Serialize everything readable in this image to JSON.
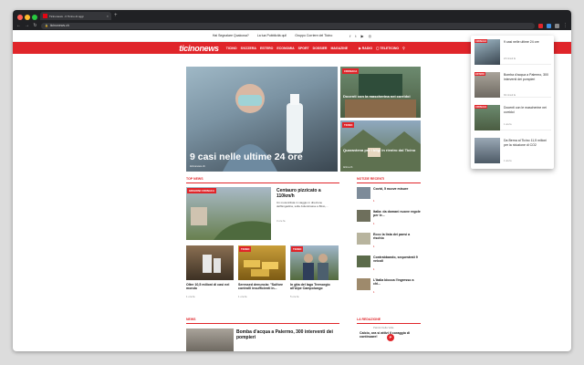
{
  "browser": {
    "tab_title": "Ticinonews - Il Ticino di oggi",
    "url": "ticinonews.ch",
    "tab_close": "×",
    "new_tab": "+",
    "colors": {
      "chrome": "#202124",
      "tab": "#35363a"
    }
  },
  "topbar": {
    "items": [
      "Hai Segnalare Qualcosa?",
      "La tua Pubblicità qui!",
      "Gruppo Corriere del Ticino"
    ],
    "social": [
      "f",
      "t",
      "▶",
      "◎"
    ]
  },
  "nav": {
    "logo": "ticinonews",
    "menu": [
      "TICINO",
      "SVIZZERA",
      "ESTERO",
      "ECONOMIA",
      "SPORT",
      "DOSSIER",
      "MAGAZINE"
    ],
    "radio": "RADIO",
    "teleticino": "TELETICINO",
    "accent": "#e0252a"
  },
  "hero": {
    "title": "9 casi nelle ultime 24 ore",
    "source": "ticinonews.ch",
    "subtitle": "Docenti con la mascherina nei corridoi",
    "subtitle_category": "CRONACA",
    "card2_title": "Quarantena per i bilgi in rientro dal Ticino",
    "card2_category": "TICINO",
    "card2_meta": "ticino.ch"
  },
  "top_news": {
    "heading": "TOP NEWS",
    "featured_category": "GRIGIONI CRONACA",
    "featured_title": "Centauro pizzicato a 110km/h",
    "featured_text": "Un motociclista in viaggio in direzione dell'Engadina, sulla Julierstrasse a Bivio,...",
    "featured_meta": "3 ore fa",
    "cards": [
      {
        "category": "",
        "title": "Oltre 10,5 milioni di casi nel mondo",
        "meta": "1 ora fa"
      },
      {
        "category": "TICINO",
        "title": "Seressed denuncia: \"Sulfore controlli insufficienti in...",
        "meta": "1 ora fa"
      },
      {
        "category": "TICINO",
        "title": "In gita del lago Tremorgio all'Alpe Campolungo",
        "meta": "5 ore fa"
      }
    ]
  },
  "recent": {
    "heading": "NOTIZIE RECENTI",
    "items": [
      {
        "title": "Covid, 5 nuove misure",
        "meta": "1"
      },
      {
        "title": "Italia: da domani nuove regole per le...",
        "meta": "1"
      },
      {
        "title": "Ecco la lista dei paesi a rischio",
        "meta": "1"
      },
      {
        "title": "Contrabbando, sequestrati 9 veicoli",
        "meta": "1"
      },
      {
        "title": "L'Italia blocca l'ingresso a chi...",
        "meta": "1"
      }
    ]
  },
  "news_section": {
    "heading": "NEWS",
    "title": "Bomba d'acqua a Palermo, 300 interventi dei pompieri"
  },
  "redazione": {
    "heading": "LA REDAZIONE",
    "author": "Patrick Della Valle",
    "quote": "Calcio, ora si attivi il coraggio di continuare!",
    "logo_letter": "P"
  },
  "popup": {
    "items": [
      {
        "category": "CRONACA",
        "title": "9 casi nelle ultime 24 ore",
        "meta": "23 minuti fa"
      },
      {
        "category": "ESTERO",
        "title": "Bomba d'acqua a Palermo, 300 interventi dei pompieri",
        "meta": "30 minuti fa"
      },
      {
        "category": "CRONACA",
        "title": "Docenti con le mascherine nei corridoi",
        "meta": "1 ora fa"
      },
      {
        "category": "",
        "title": "Da Berna al Ticino 11,5 milioni per la riduzione di CO2",
        "meta": "1 ora fa"
      }
    ]
  }
}
